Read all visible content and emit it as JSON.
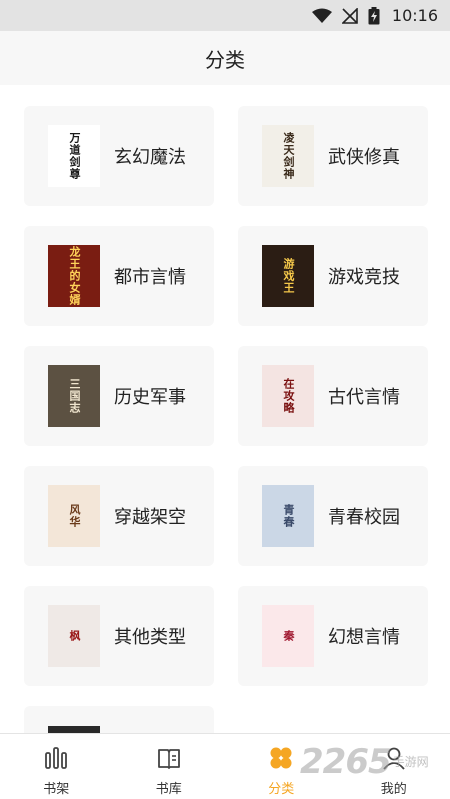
{
  "status_bar": {
    "time": "10:16"
  },
  "header": {
    "title": "分类"
  },
  "categories": [
    {
      "label": "玄幻魔法",
      "cover_text": "万道剑尊",
      "cover_bg": "#ffffff",
      "cover_fg": "#1a1a1a"
    },
    {
      "label": "武侠修真",
      "cover_text": "凌天剑神",
      "cover_bg": "#f2efe8",
      "cover_fg": "#3a2a1a"
    },
    {
      "label": "都市言情",
      "cover_text": "龙王的女婿",
      "cover_bg": "#7a1d12",
      "cover_fg": "#ffd45a"
    },
    {
      "label": "游戏竞技",
      "cover_text": "游戏王",
      "cover_bg": "#2b1d14",
      "cover_fg": "#f5c84a"
    },
    {
      "label": "历史军事",
      "cover_text": "三国志",
      "cover_bg": "#5c5142",
      "cover_fg": "#f1e6cf"
    },
    {
      "label": "古代言情",
      "cover_text": "在攻略",
      "cover_bg": "#f4e4e2",
      "cover_fg": "#7a1010"
    },
    {
      "label": "穿越架空",
      "cover_text": "风华",
      "cover_bg": "#f3e6d8",
      "cover_fg": "#6a3a1a"
    },
    {
      "label": "青春校园",
      "cover_text": "青春",
      "cover_bg": "#cbd7e6",
      "cover_fg": "#3a4a6a"
    },
    {
      "label": "其他类型",
      "cover_text": "枫",
      "cover_bg": "#efe9e6",
      "cover_fg": "#9a1818"
    },
    {
      "label": "幻想言情",
      "cover_text": "秦",
      "cover_bg": "#fbe8ea",
      "cover_fg": "#a01830"
    }
  ],
  "nav": {
    "items": [
      {
        "label": "书架",
        "icon": "bookshelf-icon"
      },
      {
        "label": "书库",
        "icon": "library-icon"
      },
      {
        "label": "分类",
        "icon": "category-icon"
      },
      {
        "label": "我的",
        "icon": "profile-icon"
      }
    ],
    "active_color": "#f5a623"
  },
  "watermark": {
    "number": "2265",
    "line1": "手游网",
    "line2": "我的"
  }
}
